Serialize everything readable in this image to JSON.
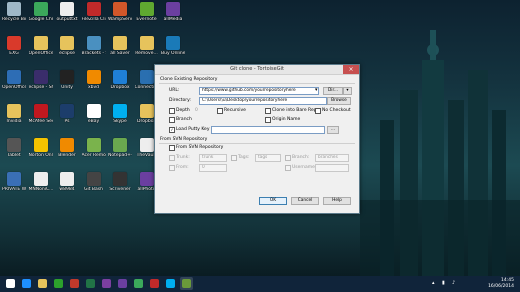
{
  "colors": {
    "accent": "#3c7fb1",
    "taskbar": "#10243a",
    "close": "#c75050"
  },
  "desktop_icons": [
    {
      "label": "Recycle Bin",
      "icon": "recycle-bin-icon",
      "color": "#9fb8c8"
    },
    {
      "label": "Google Chrome",
      "icon": "chrome-icon",
      "color": "#3ba85b"
    },
    {
      "label": "outputtxt",
      "icon": "text-file-icon",
      "color": "#eeeeee"
    },
    {
      "label": "FileZilla Client",
      "icon": "filezilla-icon",
      "color": "#c12a2a"
    },
    {
      "label": "WampServ...",
      "icon": "wamp-icon",
      "color": "#d2572a"
    },
    {
      "label": "Evernote",
      "icon": "evernote-icon",
      "color": "#5fa830"
    },
    {
      "label": "allMedia",
      "icon": "media-icon",
      "color": "#6b3fa0"
    },
    {
      "label": "EXG",
      "icon": "pdf-icon",
      "color": "#d93a2b"
    },
    {
      "label": "OpenOffice 4.1.0 en-G...",
      "icon": "folder-icon",
      "color": "#e6c35c"
    },
    {
      "label": "eclipse",
      "icon": "folder-icon",
      "color": "#e6c35c"
    },
    {
      "label": "Brackets - Shortcut",
      "icon": "brackets-icon",
      "color": "#4a90c0"
    },
    {
      "label": "all Saver",
      "icon": "folder-icon",
      "color": "#e6c35c"
    },
    {
      "label": "Remove...",
      "icon": "folder-icon",
      "color": "#e6c35c"
    },
    {
      "label": "Buy Online",
      "icon": "globe-icon",
      "color": "#1a7ab8"
    },
    {
      "label": "OpenOffice 4.1.0",
      "icon": "openoffice-icon",
      "color": "#2d6db5"
    },
    {
      "label": "eclipse - Shortcut",
      "icon": "eclipse-icon",
      "color": "#3a2d6b"
    },
    {
      "label": "Unity",
      "icon": "unity-icon",
      "color": "#222222"
    },
    {
      "label": "xbvd",
      "icon": "vlc-icon",
      "color": "#f08a00"
    },
    {
      "label": "Dropbox",
      "icon": "dropbox-icon",
      "color": "#1f7fd6"
    },
    {
      "label": "Connections Manager B...",
      "icon": "connections-icon",
      "color": "#2a6fb0"
    },
    {
      "label": "Desktop Stuff 3 Stuff",
      "icon": "folder-icon",
      "color": "#e6c35c"
    },
    {
      "label": "Invidia",
      "icon": "folder-icon",
      "color": "#e6c35c"
    },
    {
      "label": "McAfee Security Sc...",
      "icon": "mcafee-icon",
      "color": "#c0181f"
    },
    {
      "label": "Ps",
      "icon": "photoshop-icon",
      "color": "#1c3d6b"
    },
    {
      "label": "eBay",
      "icon": "ebay-icon",
      "color": "#ffffff"
    },
    {
      "label": "Skype",
      "icon": "skype-icon",
      "color": "#00aff0"
    },
    {
      "label": "Dropbox",
      "icon": "folder-icon",
      "color": "#e6c35c"
    },
    {
      "label": "DClipse",
      "icon": "dclipse-icon",
      "color": "#3a2d6b"
    },
    {
      "label": "Tablet",
      "icon": "tablet-icon",
      "color": "#555555"
    },
    {
      "label": "Norton Online...",
      "icon": "norton-icon",
      "color": "#f4c300"
    },
    {
      "label": "Blender",
      "icon": "blender-icon",
      "color": "#f08a00"
    },
    {
      "label": "Acer Remote Files",
      "icon": "acer-icon",
      "color": "#7ab34c"
    },
    {
      "label": "Notepad++",
      "icon": "notepad-icon",
      "color": "#6aa84f"
    },
    {
      "label": "TheVault",
      "icon": "text-file-icon",
      "color": "#eeeeee"
    },
    {
      "label": "HyperSnap...",
      "icon": "hypersnap-icon",
      "color": "#c0181f"
    },
    {
      "label": "PRIVATE WiFi",
      "icon": "wifi-icon",
      "color": "#3a6fb5"
    },
    {
      "label": "MNNoniC...",
      "icon": "text-file-icon",
      "color": "#eeeeee"
    },
    {
      "label": "w8984",
      "icon": "text-file-icon",
      "color": "#eeeeee"
    },
    {
      "label": "Git Bash",
      "icon": "git-bash-icon",
      "color": "#444444"
    },
    {
      "label": "Scrivener",
      "icon": "scrivener-icon",
      "color": "#333333"
    },
    {
      "label": "allPhoto",
      "icon": "photo-icon",
      "color": "#6b3fa0"
    }
  ],
  "dialog": {
    "title": "Git clone - TortoiseGit",
    "clone_group": "Clone Existing Repository",
    "url_label": "URL:",
    "url_value": "https://www.github.com/yourrepositoryhere",
    "dir_button": "Dir...",
    "directory_label": "Directory:",
    "directory_value": "C:\\Users\\\\u\\Desktop\\yourrepositoryhere",
    "browse_button": "Browse",
    "depth_label": "Depth",
    "depth_value": "0",
    "recursive_label": "Recursive",
    "bare_label": "Clone into Bare Repo",
    "no_checkout_label": "No Checkout",
    "branch_label": "Branch",
    "origin_label": "Origin Name",
    "load_putty_label": "Load Putty Key",
    "putty_browse": "...",
    "svn_group": "From SVN Repository",
    "svn_from_label": "From SVN Repository",
    "trunk_label": "Trunk:",
    "trunk_value": "trunk",
    "tags_label": "Tags:",
    "tags_value": "tags",
    "branch_svn_label": "Branch:",
    "branch_svn_value": "branches",
    "from_label": "From:",
    "from_value": "0",
    "username_label": "Username:",
    "ok_button": "OK",
    "cancel_button": "Cancel",
    "help_button": "Help"
  },
  "taskbar": {
    "apps": [
      {
        "icon": "start-icon",
        "color": "#ffffff"
      },
      {
        "icon": "ie-icon",
        "color": "#1e90ff"
      },
      {
        "icon": "file-explorer-icon",
        "color": "#e6c35c"
      },
      {
        "icon": "store-icon",
        "color": "#2ca02c"
      },
      {
        "icon": "windows-live-icon",
        "color": "#c0392b"
      },
      {
        "icon": "excel-icon",
        "color": "#217346"
      },
      {
        "icon": "onenote-icon",
        "color": "#7b3fa0"
      },
      {
        "icon": "groove-icon",
        "color": "#6b3fa0"
      },
      {
        "icon": "chrome-icon",
        "color": "#3ba85b"
      },
      {
        "icon": "filezilla-icon",
        "color": "#c12a2a"
      },
      {
        "icon": "skype-icon",
        "color": "#00aff0"
      },
      {
        "icon": "tortoisegit-icon",
        "color": "#6a9a3a"
      }
    ],
    "time": "14:45",
    "date": "16/06/2014"
  }
}
